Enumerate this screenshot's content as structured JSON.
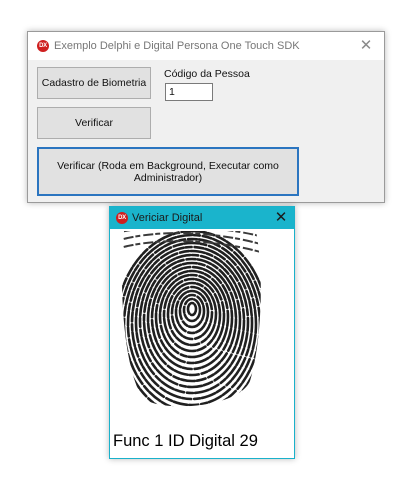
{
  "main_window": {
    "icon": "delphi-app-icon",
    "icon_text": "DX",
    "title": "Exemplo Delphi e Digital Persona One Touch SDK",
    "close": "✕",
    "cadastro_button": "Cadastro de Biometria",
    "verificar_button": "Verificar",
    "background_button": "Verificar (Roda em Background, Executar como Administrador)",
    "codigo_label": "Código da Pessoa",
    "codigo_value": "1"
  },
  "fingerprint_window": {
    "icon": "delphi-app-icon",
    "icon_text": "DX",
    "title": "Vericiar Digital",
    "close": "✕",
    "image": "fingerprint-scan",
    "caption": "Func 1 ID Digital 29"
  },
  "colors": {
    "titlebar_accent": "#1ab4cc",
    "focus_border": "#2b75c0",
    "icon_red": "#cf1f1f"
  }
}
